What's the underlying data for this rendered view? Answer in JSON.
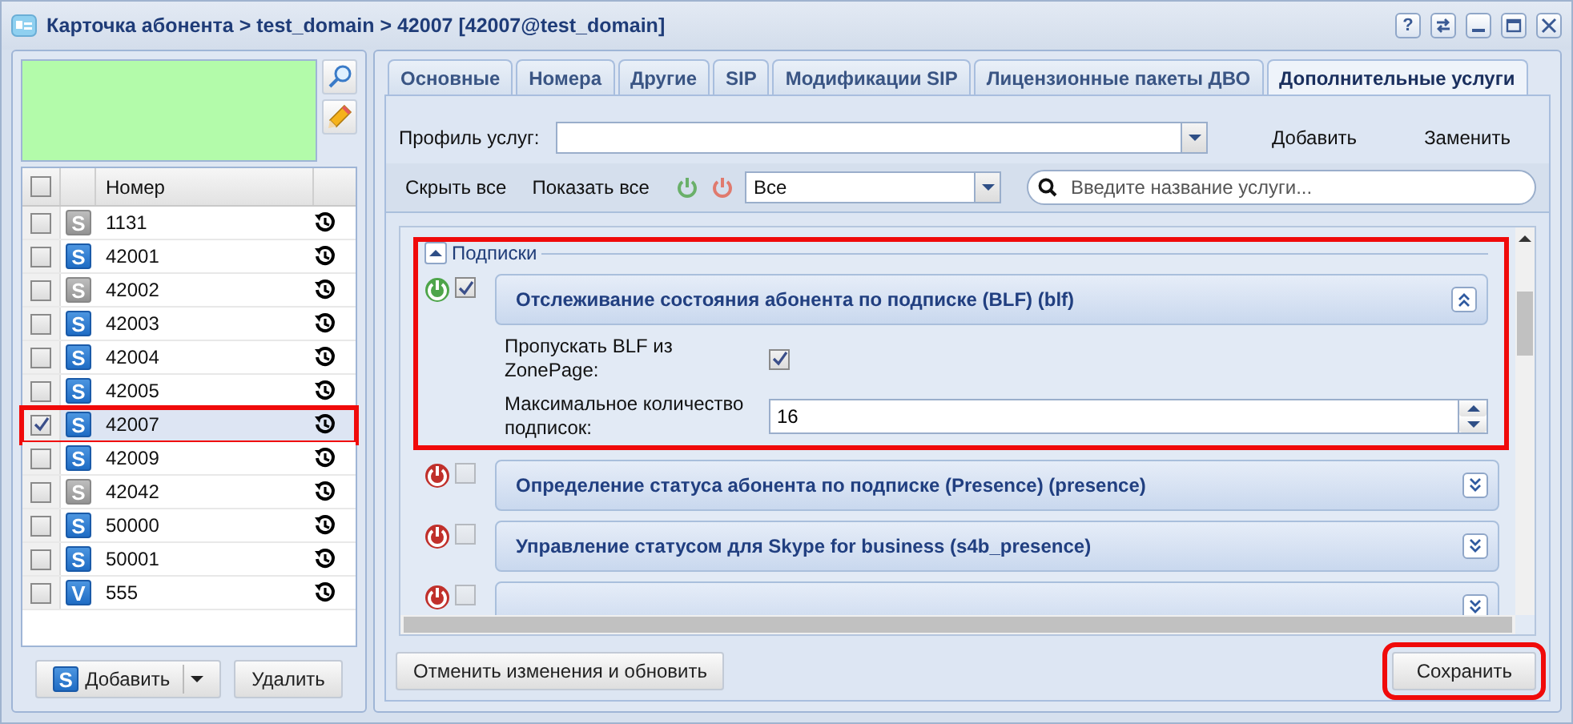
{
  "window": {
    "title": "Карточка абонента > test_domain > 42007 [42007@test_domain]",
    "help": "?"
  },
  "left": {
    "header": "Номер",
    "all_checked": false,
    "rows": [
      {
        "number": "1131",
        "badge": "S",
        "enabled": false,
        "checked": false,
        "selected": false
      },
      {
        "number": "42001",
        "badge": "S",
        "enabled": true,
        "checked": false,
        "selected": false
      },
      {
        "number": "42002",
        "badge": "S",
        "enabled": false,
        "checked": false,
        "selected": false
      },
      {
        "number": "42003",
        "badge": "S",
        "enabled": true,
        "checked": false,
        "selected": false
      },
      {
        "number": "42004",
        "badge": "S",
        "enabled": true,
        "checked": false,
        "selected": false
      },
      {
        "number": "42005",
        "badge": "S",
        "enabled": true,
        "checked": false,
        "selected": false
      },
      {
        "number": "42007",
        "badge": "S",
        "enabled": true,
        "checked": true,
        "selected": true
      },
      {
        "number": "42009",
        "badge": "S",
        "enabled": true,
        "checked": false,
        "selected": false
      },
      {
        "number": "42042",
        "badge": "S",
        "enabled": false,
        "checked": false,
        "selected": false
      },
      {
        "number": "50000",
        "badge": "S",
        "enabled": true,
        "checked": false,
        "selected": false
      },
      {
        "number": "50001",
        "badge": "S",
        "enabled": true,
        "checked": false,
        "selected": false
      },
      {
        "number": "555",
        "badge": "V",
        "enabled": true,
        "checked": false,
        "selected": false
      }
    ],
    "add_button": {
      "badge": "S",
      "label": "Добавить"
    },
    "delete_button": "Удалить"
  },
  "tabs": [
    {
      "label": "Основные",
      "selected": false
    },
    {
      "label": "Номера",
      "selected": false
    },
    {
      "label": "Другие",
      "selected": false
    },
    {
      "label": "SIP",
      "selected": false
    },
    {
      "label": "Модификации SIP",
      "selected": false
    },
    {
      "label": "Лицензионные пакеты ДВО",
      "selected": false
    },
    {
      "label": "Дополнительные услуги",
      "selected": true
    }
  ],
  "profile": {
    "label": "Профиль услуг:",
    "add": "Добавить",
    "replace": "Заменить"
  },
  "filter": {
    "hide_all": "Скрыть все",
    "show_all": "Показать все",
    "select_value": "Все",
    "search_placeholder": "Введите название услуги..."
  },
  "group": {
    "title": "Подписки",
    "expanded": true,
    "services": [
      {
        "title": "Отслеживание состояния абонента по подписке (BLF) (blf)",
        "on": true,
        "checked": true,
        "expanded": true,
        "fields": [
          {
            "kind": "checkbox",
            "label": "Пропускать BLF из ZonePage:",
            "checked": true
          },
          {
            "kind": "spinner",
            "label": "Максимальное количество подписок:",
            "value": "16"
          }
        ]
      },
      {
        "title": "Определение статуса абонента по подписке (Presence) (presence)",
        "on": false,
        "checked": false,
        "expanded": false
      },
      {
        "title": "Управление статусом для Skype for business (s4b_presence)",
        "on": false,
        "checked": false,
        "expanded": false
      },
      {
        "on": false,
        "checked": false,
        "expanded": false
      }
    ]
  },
  "footer": {
    "reset": "Отменить изменения и обновить",
    "save": "Сохранить"
  }
}
